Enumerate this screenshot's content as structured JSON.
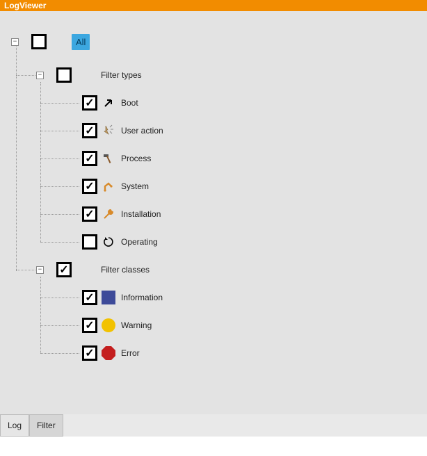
{
  "window": {
    "title": "LogViewer"
  },
  "tree": {
    "root": {
      "label": "All",
      "expanded": true,
      "checked": false
    },
    "groups": [
      {
        "id": "filter-types",
        "label": "Filter types",
        "expanded": true,
        "checked": false,
        "items": [
          {
            "id": "boot",
            "label": "Boot",
            "checked": true,
            "icon": "arrow-up-right-icon"
          },
          {
            "id": "user-action",
            "label": "User action",
            "checked": true,
            "icon": "hand-click-icon"
          },
          {
            "id": "process",
            "label": "Process",
            "checked": true,
            "icon": "hammer-icon"
          },
          {
            "id": "system",
            "label": "System",
            "checked": true,
            "icon": "robot-arm-icon"
          },
          {
            "id": "installation",
            "label": "Installation",
            "checked": true,
            "icon": "wrench-icon"
          },
          {
            "id": "operating",
            "label": "Operating",
            "checked": false,
            "icon": "refresh-icon"
          }
        ]
      },
      {
        "id": "filter-classes",
        "label": "Filter classes",
        "expanded": true,
        "checked": true,
        "items": [
          {
            "id": "information",
            "label": "Information",
            "checked": true,
            "icon": "info-square-icon",
            "color": "#3d4a99"
          },
          {
            "id": "warning",
            "label": "Warning",
            "checked": true,
            "icon": "warning-circle-icon",
            "color": "#f2c200"
          },
          {
            "id": "error",
            "label": "Error",
            "checked": true,
            "icon": "error-octagon-icon",
            "color": "#c41e1e"
          }
        ]
      }
    ]
  },
  "tabs": {
    "items": [
      {
        "id": "log",
        "label": "Log",
        "active": false
      },
      {
        "id": "filter",
        "label": "Filter",
        "active": true
      }
    ]
  }
}
